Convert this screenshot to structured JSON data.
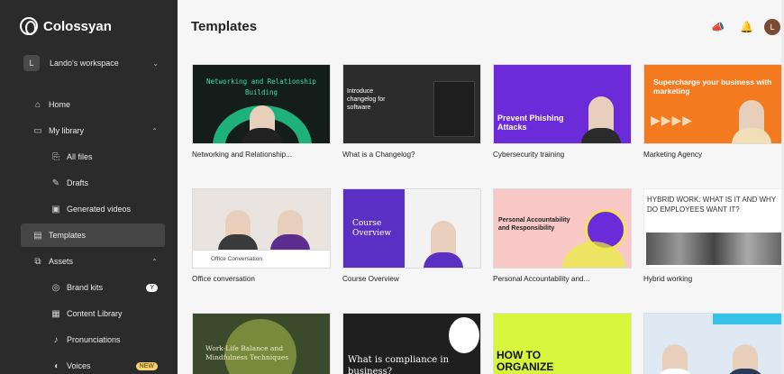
{
  "brand": {
    "name": "Colossyan"
  },
  "workspace": {
    "initial": "L",
    "name": "Lando's workspace"
  },
  "nav": {
    "home": "Home",
    "my_library": "My library",
    "all_files": "All files",
    "drafts": "Drafts",
    "generated_videos": "Generated videos",
    "templates": "Templates",
    "assets": "Assets",
    "brand_kits": "Brand kits",
    "content_library": "Content Library",
    "pronunciations": "Pronunciations",
    "voices": "Voices",
    "voices_badge": "NEW",
    "brand_kits_badge": "Y"
  },
  "header": {
    "title": "Templates",
    "avatar": "L"
  },
  "templates": [
    {
      "caption": "Networking and Relationship...",
      "thumb_text": "Networking and Relationship Building"
    },
    {
      "caption": "What is a Changelog?",
      "thumb_text": "Introduce changelog for software"
    },
    {
      "caption": "Cybersecurity training",
      "thumb_text": "Prevent Phishing Attacks"
    },
    {
      "caption": "Marketing Agency",
      "thumb_text": "Supercharge your business with marketing"
    },
    {
      "caption": "Office conversation",
      "thumb_text": "Office Conversation"
    },
    {
      "caption": "Course Overview",
      "thumb_text": "Course Overview"
    },
    {
      "caption": "Personal Accountability and...",
      "thumb_text": "Personal Accountability and Responsibility"
    },
    {
      "caption": "Hybrid working",
      "thumb_text": "HYBRID WORK: WHAT IS IT AND WHY DO EMPLOYEES WANT IT?"
    },
    {
      "caption": "",
      "thumb_text": "Work-Life Balance and Mindfulness Techniques"
    },
    {
      "caption": "",
      "thumb_text": "What is compliance in business?"
    },
    {
      "caption": "",
      "thumb_text": "HOW TO ORGANIZE"
    },
    {
      "caption": "",
      "thumb_text": ""
    }
  ],
  "colors": {
    "sidebar": "#2b2b2b",
    "accent_orange": "#f47a1f",
    "accent_purple": "#6b2bd8",
    "accent_lime": "#d7f53a"
  }
}
